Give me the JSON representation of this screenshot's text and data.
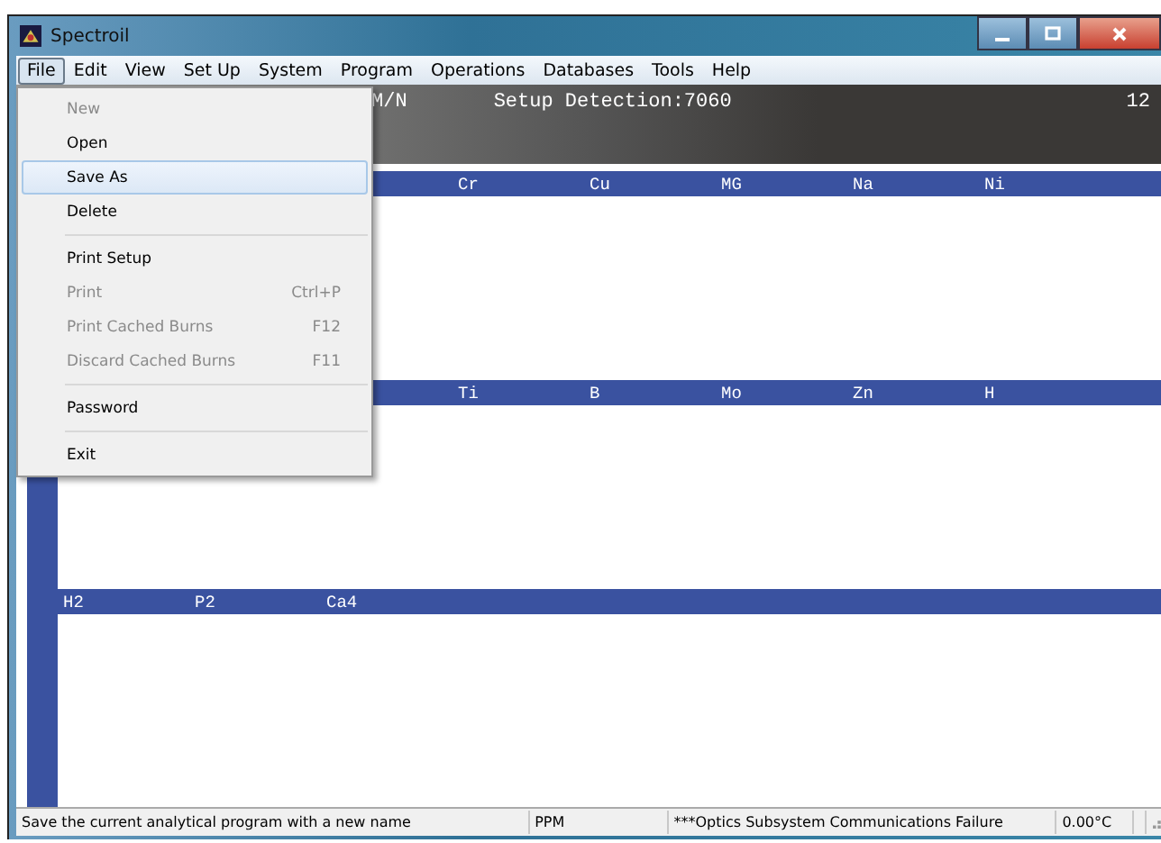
{
  "window": {
    "title": "Spectroil"
  },
  "menu_bar": [
    {
      "label": "File",
      "selected": true
    },
    {
      "label": "Edit",
      "selected": false
    },
    {
      "label": "View",
      "selected": false
    },
    {
      "label": "Set Up",
      "selected": false
    },
    {
      "label": "System",
      "selected": false
    },
    {
      "label": "Program",
      "selected": false
    },
    {
      "label": "Operations",
      "selected": false
    },
    {
      "label": "Databases",
      "selected": false
    },
    {
      "label": "Tools",
      "selected": false
    },
    {
      "label": "Help",
      "selected": false
    }
  ],
  "file_menu": [
    {
      "kind": "item",
      "label": "New",
      "disabled": true,
      "selected": false
    },
    {
      "kind": "item",
      "label": "Open",
      "disabled": false,
      "selected": false
    },
    {
      "kind": "item",
      "label": "Save As",
      "disabled": false,
      "selected": true
    },
    {
      "kind": "item",
      "label": "Delete",
      "disabled": false,
      "selected": false
    },
    {
      "kind": "separator"
    },
    {
      "kind": "item",
      "label": "Print Setup",
      "disabled": false,
      "selected": false
    },
    {
      "kind": "item",
      "label": "Print",
      "shortcut": "Ctrl+P",
      "disabled": true,
      "selected": false
    },
    {
      "kind": "item",
      "label": "Print Cached Burns",
      "shortcut": "F12",
      "disabled": true,
      "selected": false
    },
    {
      "kind": "item",
      "label": "Discard Cached Burns",
      "shortcut": "F11",
      "disabled": true,
      "selected": false
    },
    {
      "kind": "separator"
    },
    {
      "kind": "item",
      "label": "Password",
      "disabled": false,
      "selected": false
    },
    {
      "kind": "separator"
    },
    {
      "kind": "item",
      "label": "Exit",
      "disabled": false,
      "selected": false
    }
  ],
  "header": {
    "mode": "M/N",
    "detection": "Setup Detection:7060",
    "count": "12"
  },
  "element_bands": [
    {
      "columns": [
        null,
        null,
        null,
        "Cr",
        "Cu",
        "MG",
        "Na",
        "Ni"
      ]
    },
    {
      "columns": [
        null,
        null,
        null,
        "Ti",
        "B",
        "Mo",
        "Zn",
        "H"
      ]
    },
    {
      "columns": [
        "H2",
        "P2",
        "Ca4",
        null,
        null,
        null,
        null,
        null
      ]
    }
  ],
  "status_bar": [
    "Save the current analytical program with a new name",
    "PPM",
    "***Optics Subsystem Communications Failure",
    "0.00°C"
  ]
}
